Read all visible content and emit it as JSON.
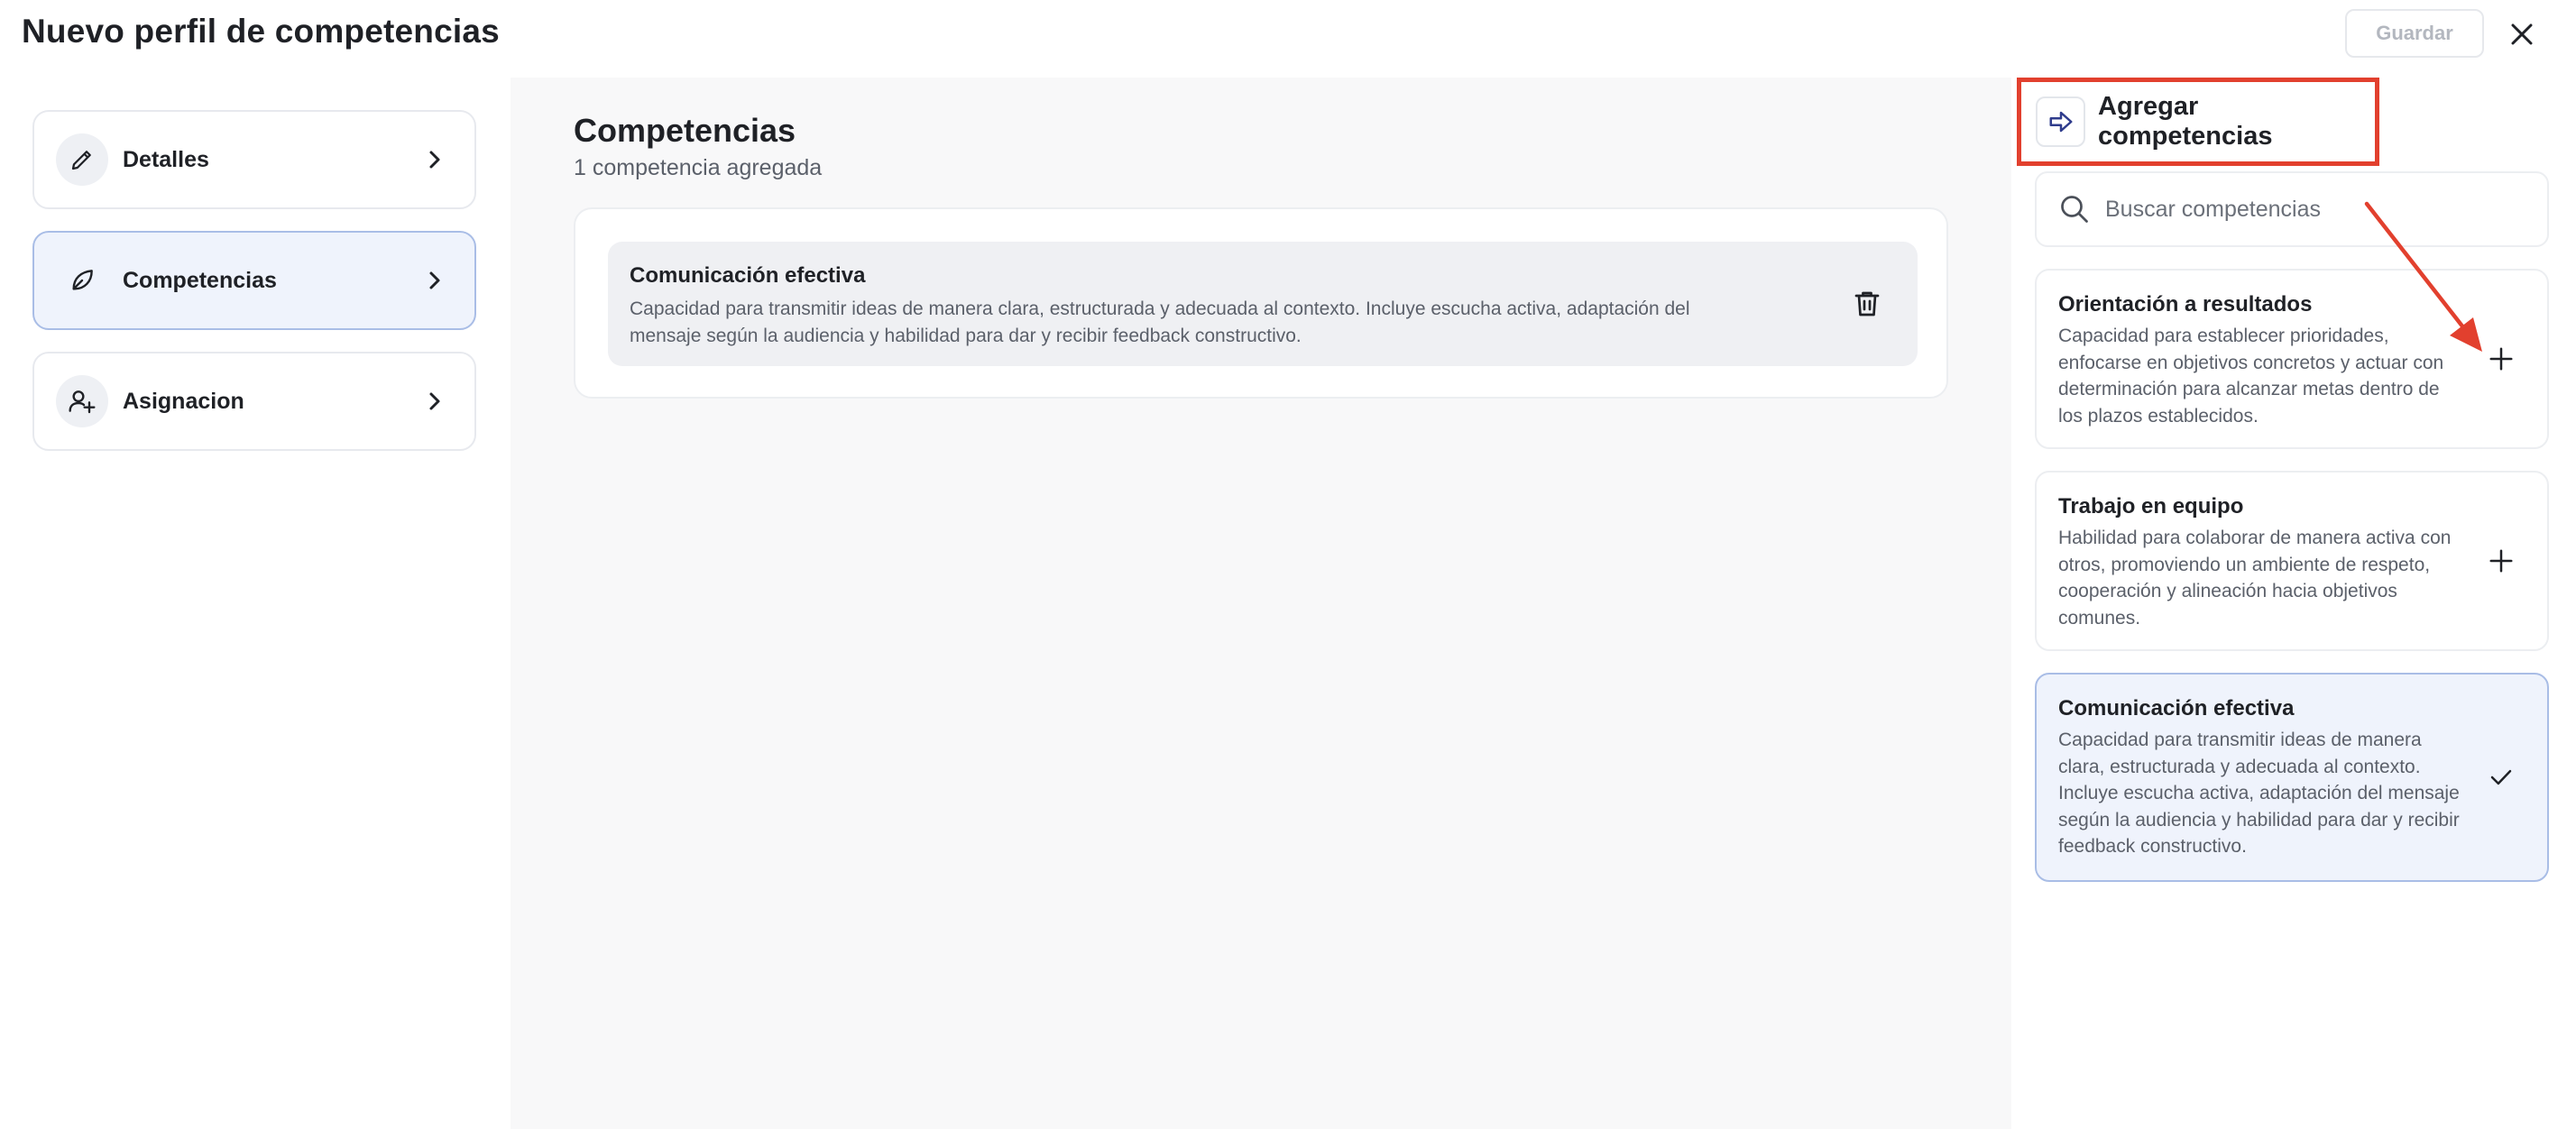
{
  "header": {
    "title": "Nuevo perfil de competencias",
    "save_label": "Guardar"
  },
  "nav": {
    "items": [
      {
        "label": "Detalles",
        "icon": "pencil-icon"
      },
      {
        "label": "Competencias",
        "icon": "leaf-icon",
        "active": true
      },
      {
        "label": "Asignacion",
        "icon": "user-add-icon"
      }
    ]
  },
  "middle": {
    "title": "Competencias",
    "subtitle": "1 competencia agregada",
    "added": [
      {
        "name": "Comunicación efectiva",
        "description": "Capacidad para transmitir ideas de manera clara, estructurada y adecuada al contexto. Incluye escucha activa, adaptación del mensaje según la audiencia y habilidad para dar y recibir feedback constructivo."
      }
    ]
  },
  "right": {
    "title": "Agregar competencias",
    "search_placeholder": "Buscar competencias",
    "options": [
      {
        "name": "Orientación a resultados",
        "description": "Capacidad para establecer prioridades, enfocarse en objetivos concretos y actuar con determinación para alcanzar metas dentro de los plazos establecidos.",
        "state": "add"
      },
      {
        "name": "Trabajo en equipo",
        "description": "Habilidad para colaborar de manera activa con otros, promoviendo un ambiente de respeto, cooperación y alineación hacia objetivos comunes.",
        "state": "add"
      },
      {
        "name": "Comunicación efectiva",
        "description": "Capacidad para transmitir ideas de manera clara, estructurada y adecuada al contexto. Incluye escucha activa, adaptación del mensaje según la audiencia y habilidad para dar y recibir feedback constructivo.",
        "state": "selected"
      }
    ]
  },
  "colors": {
    "accent_border": "#a9bde6",
    "accent_bg": "#eff3fc",
    "annotation_red": "#e2402e",
    "icon_blue": "#2f3c8c"
  }
}
